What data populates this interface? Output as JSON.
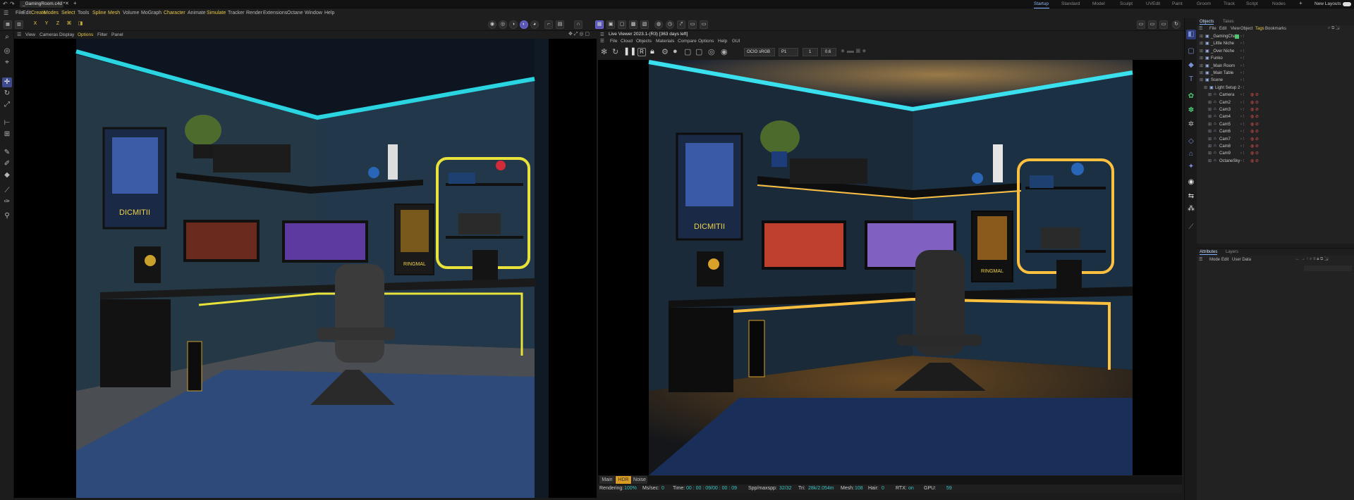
{
  "title_bar": {
    "file_tab": "_GamingRoom.c4d *",
    "layouts": [
      "Startup",
      "Standard",
      "Model",
      "Sculpt",
      "UVEdit",
      "Paint",
      "Groom",
      "Track",
      "Script",
      "Nodes"
    ],
    "new_layouts": "New Layouts"
  },
  "main_menu": [
    "File",
    "Edit",
    "Create",
    "Modes",
    "Select",
    "Tools",
    "Spline",
    "Mesh",
    "Volume",
    "MoGraph",
    "Character",
    "Animate",
    "Simulate",
    "Tracker",
    "Render",
    "Extensions",
    "Octane",
    "Window",
    "Help"
  ],
  "axis_toggles": [
    "X",
    "Y",
    "Z"
  ],
  "viewport": {
    "menu": [
      "View",
      "Cameras",
      "Display",
      "Options",
      "Filter",
      "Panel"
    ]
  },
  "live_viewer": {
    "title": "Live Viewer 2023.1-(R3) [363 days left]",
    "menu": [
      "File",
      "Cloud",
      "Objects",
      "Materials",
      "Compare",
      "Options",
      "Help",
      "GUI"
    ],
    "buttons": [
      "R"
    ],
    "color_space": "OCIO sRGB",
    "channel": "P1",
    "value1": "1",
    "value2": "0.6",
    "tabs": [
      "Main",
      "HDR",
      "Noise"
    ],
    "status": {
      "rendering_label": "Rendering:",
      "rendering": "100%",
      "ms_label": "Ms/sec:",
      "ms": "0",
      "time_label": "Time:",
      "time": "00 : 00 : 09/00 : 00 : 09",
      "spp_label": "Spp/maxspp:",
      "spp": "32/32",
      "tri_label": "Tri:",
      "tri": "28k/2.054m",
      "mesh_label": "Mesh:",
      "mesh": "108",
      "hair_label": "Hair:",
      "hair": "0",
      "rtx_label": "RTX:",
      "rtx": "on",
      "gpu_label": "GPU:",
      "gpu": "59"
    }
  },
  "objects_panel": {
    "tabs": [
      "Objects",
      "Takes"
    ],
    "menu": [
      "File",
      "Edit",
      "View",
      "Object",
      "Tags",
      "Bookmarks"
    ],
    "items": [
      {
        "name": "_GamingChair",
        "indent": 0
      },
      {
        "name": "_Little Niche",
        "indent": 0
      },
      {
        "name": "_Over Niche",
        "indent": 0
      },
      {
        "name": "Funko",
        "indent": 0
      },
      {
        "name": "_Main Room",
        "indent": 0
      },
      {
        "name": "_Main Table",
        "indent": 0
      },
      {
        "name": "Scene",
        "indent": 0
      },
      {
        "name": "Light Setup 2",
        "indent": 1
      },
      {
        "name": "Camera",
        "indent": 2
      },
      {
        "name": "Cam2",
        "indent": 2
      },
      {
        "name": "Cam3",
        "indent": 2
      },
      {
        "name": "Cam4",
        "indent": 2
      },
      {
        "name": "Cam5",
        "indent": 2
      },
      {
        "name": "Cam6",
        "indent": 2
      },
      {
        "name": "Cam7",
        "indent": 2
      },
      {
        "name": "Cam8",
        "indent": 2
      },
      {
        "name": "Cam9",
        "indent": 2
      },
      {
        "name": "OctaneSky",
        "indent": 2
      }
    ]
  },
  "attributes_panel": {
    "tabs": [
      "Attributes",
      "Layers"
    ],
    "menu": [
      "Mode",
      "Edit",
      "User Data"
    ]
  },
  "posters": {
    "left": "DICMITII",
    "right": "RINGMAL"
  },
  "colors": {
    "accent_purple": "#5a56b8",
    "neon_yellow": "#e8e23a",
    "neon_cyan": "#2ad4e0",
    "status_cyan": "#37c4c4",
    "status_yellow": "#e6c84a"
  }
}
